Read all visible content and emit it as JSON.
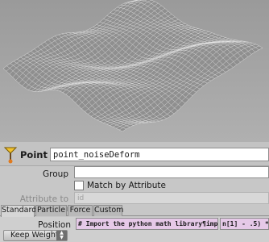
{
  "node": {
    "type_label": "Point",
    "name": "point_noiseDeform",
    "icon": "point-sop-icon"
  },
  "params": {
    "group_label": "Group",
    "group_value": "",
    "match_by_attribute_label": "Match by Attribute",
    "match_by_attribute_checked": false,
    "attribute_to_match_label": "Attribute to Match",
    "attribute_to_match_value": "id"
  },
  "tabs": [
    {
      "label": "Standard",
      "active": true
    },
    {
      "label": "Particle",
      "active": false
    },
    {
      "label": "Force",
      "active": false
    },
    {
      "label": "Custom",
      "active": false
    }
  ],
  "standard": {
    "position_label": "Position",
    "position_x_expr": "# Import the python math library¶impo",
    "position_y_expr": "n[1] - .5) * ",
    "keep_weight_label": "Keep Weight"
  },
  "colors": {
    "expression_field": "#e6c9e8",
    "viewport_background": "#a6a6a6",
    "mesh_line": "#f2f2f2"
  }
}
